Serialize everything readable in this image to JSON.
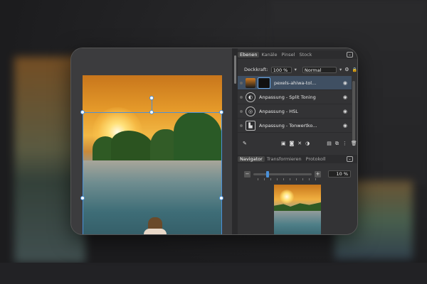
{
  "panel": {
    "tabs": [
      "Ebenen",
      "Kanäle",
      "Pinsel",
      "Stock"
    ],
    "opacity_label": "Deckkraft:",
    "opacity_value": "100 %",
    "blend_mode": "Normal",
    "layers": [
      {
        "name": "pexels-ahiwa-tol...",
        "type": "image",
        "selected": true
      },
      {
        "name": "Anpassung - Split Toning",
        "type": "adjustment",
        "icon": "split-toning-icon"
      },
      {
        "name": "Anpassung - HSL",
        "type": "adjustment",
        "icon": "hsl-icon"
      },
      {
        "name": "Anpassung - Tonwertko...",
        "type": "adjustment",
        "icon": "levels-icon"
      }
    ],
    "nav_tabs": [
      "Navigator",
      "Transformieren",
      "Protokoll"
    ],
    "zoom_value": "10 %"
  },
  "colors": {
    "accent": "#4a90d9",
    "panel_bg": "#333335",
    "selected_layer": "#3f4f62"
  }
}
